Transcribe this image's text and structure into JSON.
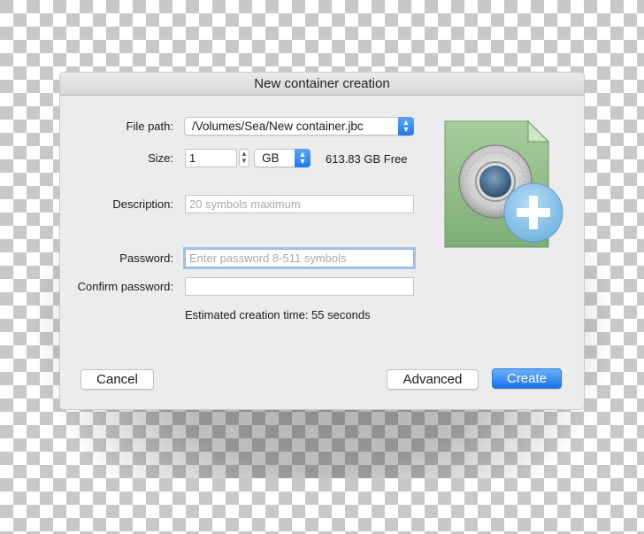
{
  "dialog": {
    "title": "New container creation",
    "file_path": {
      "label": "File path:",
      "value": "/Volumes/Sea/New container.jbc"
    },
    "size": {
      "label": "Size:",
      "value": "1",
      "unit": "GB",
      "free_space": "613.83 GB Free"
    },
    "description": {
      "label": "Description:",
      "value": "",
      "placeholder": "20 symbols maximum"
    },
    "password": {
      "label": "Password:",
      "value": "",
      "placeholder": "Enter password 8-511 symbols"
    },
    "confirm_password": {
      "label": "Confirm password:",
      "value": "",
      "placeholder": ""
    },
    "estimate": "Estimated creation time: 55 seconds",
    "icon": "encrypted-container-add-icon",
    "buttons": {
      "cancel": "Cancel",
      "advanced": "Advanced",
      "create": "Create"
    }
  },
  "colors": {
    "accent": "#1f78ee",
    "container_green": "#86b47f",
    "plus_badge": "#8fc6ea"
  }
}
